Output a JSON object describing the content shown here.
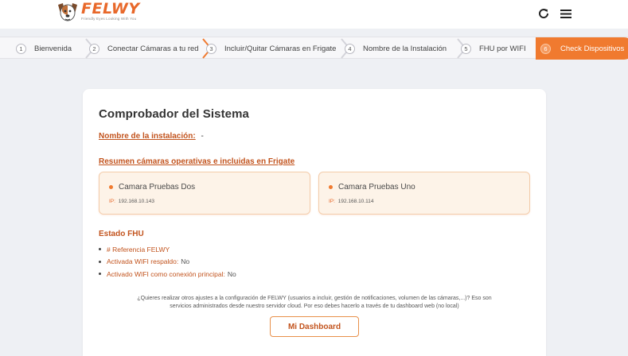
{
  "app": {
    "logo_text": "FELWY",
    "logo_tagline": "Friendly Eyes Looking With You"
  },
  "header": {
    "refresh_icon": "refresh-icon",
    "menu_icon": "hamburger-menu-icon"
  },
  "steps": [
    {
      "num": "1",
      "label": "Bienvenida"
    },
    {
      "num": "2",
      "label": "Conectar Cámaras a tu red"
    },
    {
      "num": "3",
      "label": "Incluir/Quitar Cámaras en Frigate"
    },
    {
      "num": "4",
      "label": "Nombre de la Instalación"
    },
    {
      "num": "5",
      "label": "FHU por WIFI"
    },
    {
      "num": "6",
      "label": "Check Dispositivos",
      "active": true
    }
  ],
  "main": {
    "title": "Comprobador del Sistema",
    "installation_label": "Nombre de la instalación:",
    "installation_value": "-",
    "cameras_section": "Resumen cámaras operativas e incluidas en Frigate",
    "cameras": [
      {
        "name": "Camara Pruebas Dos",
        "ip_label": "IP:",
        "ip": "192.168.10.143"
      },
      {
        "name": "Camara Pruebas Uno",
        "ip_label": "IP:",
        "ip": "192.168.10.114"
      }
    ],
    "fhu_title": "Estado FHU",
    "fhu_items": [
      {
        "label": "# Referencia FELWY",
        "value": ""
      },
      {
        "label": "Activada WIFI respaldo:",
        "value": "No"
      },
      {
        "label": "Activado WIFI como conexión principal:",
        "value": "No"
      }
    ],
    "info_line1": "¿Quieres realizar otros ajustes a la configuración de FELWY (usuarios a incluir, gestión de notificaciones, volumen de las cámaras,...)? Eso son",
    "info_line2": "servicios administrados desde nuestro servidor cloud. Por eso debes hacerlo a través de tu dashboard web (no local)",
    "dashboard_button": "Mi Dashboard"
  },
  "colors": {
    "accent": "#f07a2f",
    "label": "#c2531d",
    "camera_card_bg": "#fdf3e8"
  }
}
